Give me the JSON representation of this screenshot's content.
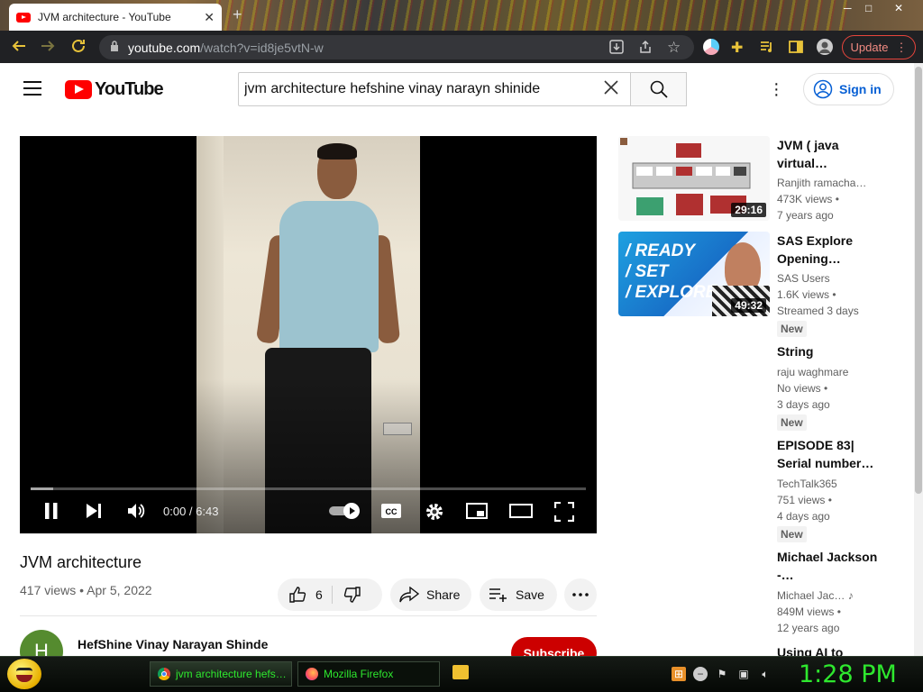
{
  "browser": {
    "tab_title": "JVM architecture - YouTube",
    "tab_close": "✕",
    "new_tab": "+",
    "url_host": "youtube.com",
    "url_rest": "/watch?v=id8je5vtN-w",
    "update_label": "Update",
    "window_min": "─",
    "window_max": "□",
    "window_close": "✕"
  },
  "youtube": {
    "logo_text": "YouTube",
    "search_query": "jvm architecture hefshine vinay narayn shinide",
    "sign_in": "Sign in"
  },
  "player": {
    "time": "0:00 / 6:43",
    "progress_loaded": 0.04,
    "autoplay": true
  },
  "video": {
    "title": "JVM architecture",
    "meta": "417 views • Apr 5, 2022",
    "likes": "6",
    "share": "Share",
    "save": "Save",
    "channel_initial": "H",
    "channel_name": "HefShine Vinay Narayan Shinde",
    "subscribe": "Subscribe"
  },
  "recommendations": [
    {
      "title": "JVM ( java virtual…",
      "channel": "Ranjith ramacha…",
      "views": "473K views •",
      "age": "7 years ago",
      "duration": "29:16"
    },
    {
      "title": "SAS Explore Opening…",
      "channel": "SAS Users",
      "views": "1.6K views •",
      "age": "Streamed 3 days",
      "badge": "New",
      "duration": "49:32",
      "thumb_text_1": "/ READY",
      "thumb_text_2": "/ SET",
      "thumb_text_3": "/ EXPLORE"
    },
    {
      "title": "String",
      "channel": "raju waghmare",
      "views": "No views •",
      "age": "3 days ago",
      "badge": "New"
    },
    {
      "title": "EPISODE 83| Serial number…",
      "channel": "TechTalk365",
      "views": "751 views •",
      "age": "4 days ago",
      "badge": "New"
    },
    {
      "title": "Michael Jackson -…",
      "channel": "Michael Jac…",
      "views": "849M views •",
      "age": "12 years ago"
    },
    {
      "title": "Using AI to"
    }
  ],
  "taskbar": {
    "task1": "jvm architecture hefs…",
    "task2": "Mozilla Firefox",
    "clock": "1:28 PM"
  },
  "colors": {
    "youtube_red": "#ff0000",
    "link_blue": "#065fd4",
    "subscribe_red": "#cc0000",
    "taskbar_green": "#2ee82e"
  }
}
